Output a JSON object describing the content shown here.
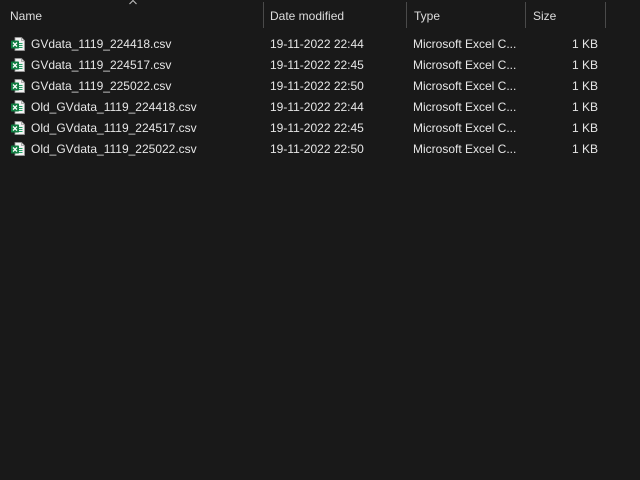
{
  "columns": {
    "name": "Name",
    "date": "Date modified",
    "type": "Type",
    "size": "Size"
  },
  "sort": {
    "column": "name",
    "icon": "chevron-up-icon"
  },
  "file_icon": "excel-csv-icon",
  "files": [
    {
      "name": "GVdata_1119_224418.csv",
      "date": "19-11-2022 22:44",
      "type": "Microsoft Excel C...",
      "size": "1 KB"
    },
    {
      "name": "GVdata_1119_224517.csv",
      "date": "19-11-2022 22:45",
      "type": "Microsoft Excel C...",
      "size": "1 KB"
    },
    {
      "name": "GVdata_1119_225022.csv",
      "date": "19-11-2022 22:50",
      "type": "Microsoft Excel C...",
      "size": "1 KB"
    },
    {
      "name": "Old_GVdata_1119_224418.csv",
      "date": "19-11-2022 22:44",
      "type": "Microsoft Excel C...",
      "size": "1 KB"
    },
    {
      "name": "Old_GVdata_1119_224517.csv",
      "date": "19-11-2022 22:45",
      "type": "Microsoft Excel C...",
      "size": "1 KB"
    },
    {
      "name": "Old_GVdata_1119_225022.csv",
      "date": "19-11-2022 22:50",
      "type": "Microsoft Excel C...",
      "size": "1 KB"
    }
  ]
}
